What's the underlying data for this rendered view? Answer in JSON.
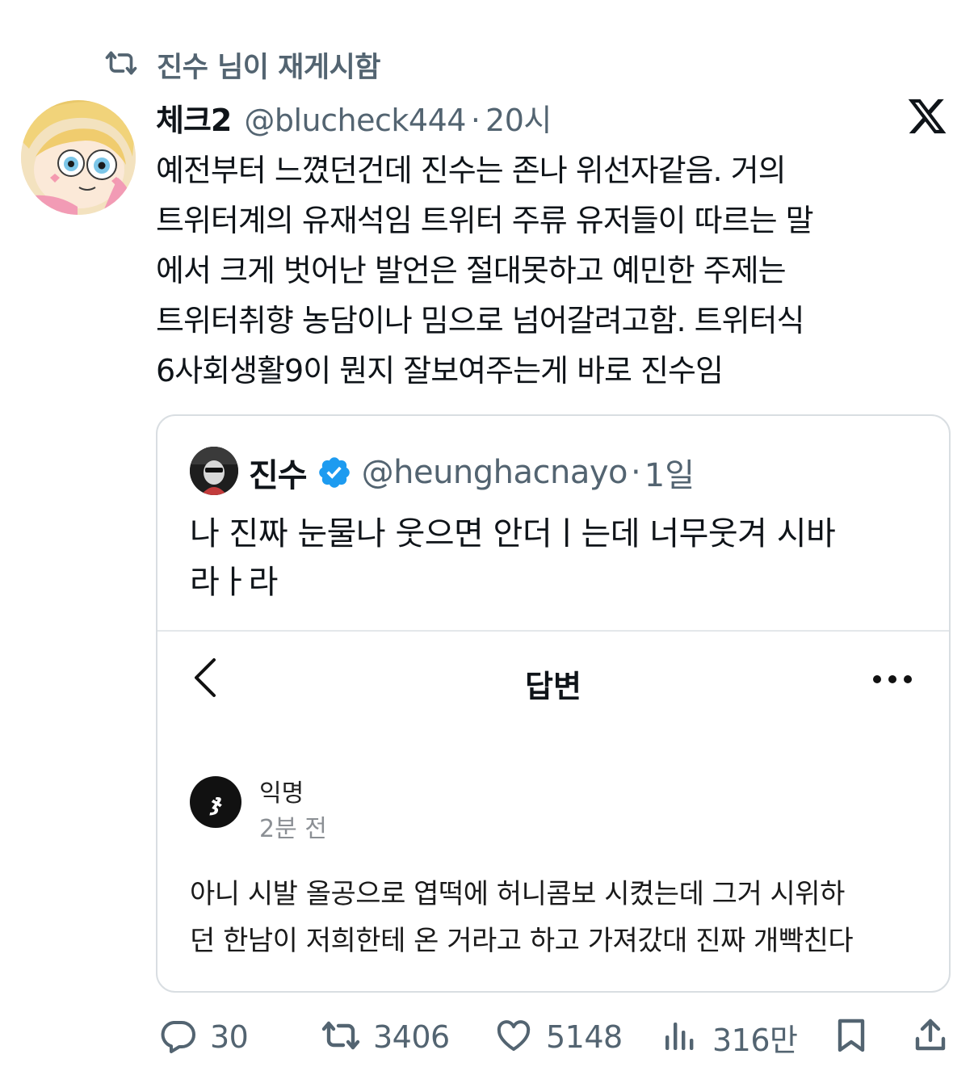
{
  "repost": {
    "icon": "repost-icon",
    "text": "진수 님이 재게시함"
  },
  "tweet": {
    "avatar_icon": "avatar-cartoon-girl",
    "display_name": "체크2",
    "handle": "@blucheck444",
    "separator": "·",
    "time": "20시",
    "platform_icon": "x-logo-icon",
    "text_lines": [
      "예전부터 느꼈던건데 진수는 존나 위선자같음. 거의",
      "트위터계의 유재석임 트위터 주류 유저들이 따르는 말",
      "에서 크게 벗어난 발언은 절대못하고 예민한 주제는",
      "트위터취향 농담이나 밈으로 넘어갈려고함. 트위터식",
      "6사회생활9이 뭔지 잘보여주는게 바로 진수임"
    ]
  },
  "quote": {
    "display_name": "진수",
    "verified_icon": "verified-badge-icon",
    "verified_color": "#1d9bf0",
    "handle": "@heunghacnayo",
    "separator": "·",
    "time": "1일",
    "text_lines": [
      "나 진짜 눈물나 웃으면 안더ㅣ는데 너무웃겨 시바",
      "라ㅏ라"
    ],
    "embed": {
      "back_icon": "chevron-left-icon",
      "title": "답변",
      "more_icon": "more-horizontal-icon",
      "author": {
        "avatar_icon": "anonymous-logo-icon",
        "avatar_glyph": "ჯ",
        "name": "익명",
        "time": "2분 전"
      },
      "text_lines": [
        "아니 시발 올공으로 엽떡에 허니콤보 시켰는데 그거 시위하",
        "던 한남이 저희한테 온 거라고 하고 가져갔대 진짜 개빡친다"
      ]
    }
  },
  "actions": {
    "reply": {
      "icon": "reply-icon",
      "count": "30"
    },
    "repost": {
      "icon": "repost-icon",
      "count": "3406"
    },
    "like": {
      "icon": "heart-icon",
      "count": "5148"
    },
    "views": {
      "icon": "views-chart-icon",
      "count": "316만"
    },
    "bookmark": {
      "icon": "bookmark-icon"
    },
    "share": {
      "icon": "share-icon"
    }
  },
  "colors": {
    "text": "#0f1419",
    "secondary": "#536471",
    "border": "#d9dee2",
    "verified": "#1d9bf0"
  }
}
